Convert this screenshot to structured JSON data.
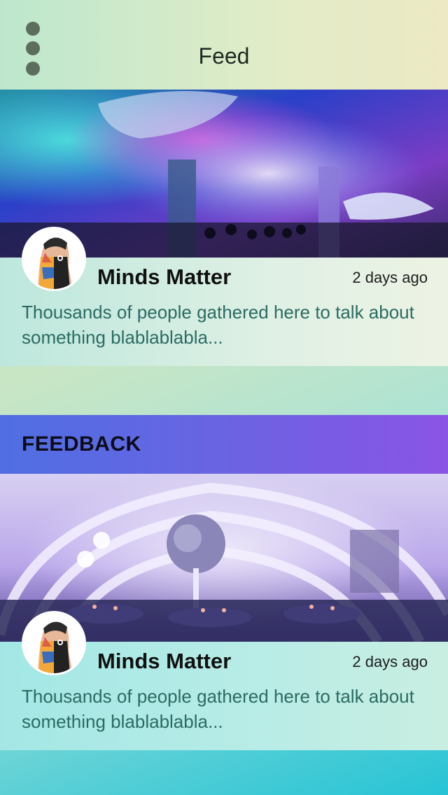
{
  "header": {
    "title": "Feed",
    "menu_icon": "more-vertical-icon"
  },
  "posts": [
    {
      "image_alt": "aquarium-event-photo",
      "avatar": "avatar-image",
      "author": "Minds Matter",
      "time": "2 days ago",
      "text": "Thousands of people gathered here to talk about something blablablabla..."
    },
    {
      "image_alt": "banquet-hall-photo",
      "avatar": "avatar-image",
      "author": "Minds Matter",
      "time": "2 days ago",
      "text": "Thousands of people gathered here to talk about something blablablabla..."
    }
  ],
  "section": {
    "title": "FEEDBACK"
  },
  "colors": {
    "accent_gradient_start": "#4f6fe2",
    "accent_gradient_end": "#8a54e4",
    "body_text": "#2b6b63"
  }
}
